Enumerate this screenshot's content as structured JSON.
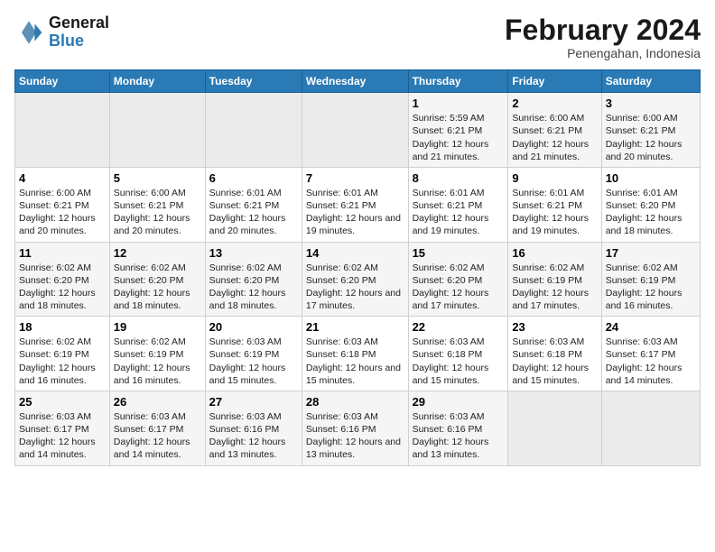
{
  "logo": {
    "text_general": "General",
    "text_blue": "Blue"
  },
  "header": {
    "title": "February 2024",
    "subtitle": "Penengahan, Indonesia"
  },
  "days_of_week": [
    "Sunday",
    "Monday",
    "Tuesday",
    "Wednesday",
    "Thursday",
    "Friday",
    "Saturday"
  ],
  "weeks": [
    [
      {
        "day": "",
        "info": ""
      },
      {
        "day": "",
        "info": ""
      },
      {
        "day": "",
        "info": ""
      },
      {
        "day": "",
        "info": ""
      },
      {
        "day": "1",
        "info": "Sunrise: 5:59 AM\nSunset: 6:21 PM\nDaylight: 12 hours and 21 minutes."
      },
      {
        "day": "2",
        "info": "Sunrise: 6:00 AM\nSunset: 6:21 PM\nDaylight: 12 hours and 21 minutes."
      },
      {
        "day": "3",
        "info": "Sunrise: 6:00 AM\nSunset: 6:21 PM\nDaylight: 12 hours and 20 minutes."
      }
    ],
    [
      {
        "day": "4",
        "info": "Sunrise: 6:00 AM\nSunset: 6:21 PM\nDaylight: 12 hours and 20 minutes."
      },
      {
        "day": "5",
        "info": "Sunrise: 6:00 AM\nSunset: 6:21 PM\nDaylight: 12 hours and 20 minutes."
      },
      {
        "day": "6",
        "info": "Sunrise: 6:01 AM\nSunset: 6:21 PM\nDaylight: 12 hours and 20 minutes."
      },
      {
        "day": "7",
        "info": "Sunrise: 6:01 AM\nSunset: 6:21 PM\nDaylight: 12 hours and 19 minutes."
      },
      {
        "day": "8",
        "info": "Sunrise: 6:01 AM\nSunset: 6:21 PM\nDaylight: 12 hours and 19 minutes."
      },
      {
        "day": "9",
        "info": "Sunrise: 6:01 AM\nSunset: 6:21 PM\nDaylight: 12 hours and 19 minutes."
      },
      {
        "day": "10",
        "info": "Sunrise: 6:01 AM\nSunset: 6:20 PM\nDaylight: 12 hours and 18 minutes."
      }
    ],
    [
      {
        "day": "11",
        "info": "Sunrise: 6:02 AM\nSunset: 6:20 PM\nDaylight: 12 hours and 18 minutes."
      },
      {
        "day": "12",
        "info": "Sunrise: 6:02 AM\nSunset: 6:20 PM\nDaylight: 12 hours and 18 minutes."
      },
      {
        "day": "13",
        "info": "Sunrise: 6:02 AM\nSunset: 6:20 PM\nDaylight: 12 hours and 18 minutes."
      },
      {
        "day": "14",
        "info": "Sunrise: 6:02 AM\nSunset: 6:20 PM\nDaylight: 12 hours and 17 minutes."
      },
      {
        "day": "15",
        "info": "Sunrise: 6:02 AM\nSunset: 6:20 PM\nDaylight: 12 hours and 17 minutes."
      },
      {
        "day": "16",
        "info": "Sunrise: 6:02 AM\nSunset: 6:19 PM\nDaylight: 12 hours and 17 minutes."
      },
      {
        "day": "17",
        "info": "Sunrise: 6:02 AM\nSunset: 6:19 PM\nDaylight: 12 hours and 16 minutes."
      }
    ],
    [
      {
        "day": "18",
        "info": "Sunrise: 6:02 AM\nSunset: 6:19 PM\nDaylight: 12 hours and 16 minutes."
      },
      {
        "day": "19",
        "info": "Sunrise: 6:02 AM\nSunset: 6:19 PM\nDaylight: 12 hours and 16 minutes."
      },
      {
        "day": "20",
        "info": "Sunrise: 6:03 AM\nSunset: 6:19 PM\nDaylight: 12 hours and 15 minutes."
      },
      {
        "day": "21",
        "info": "Sunrise: 6:03 AM\nSunset: 6:18 PM\nDaylight: 12 hours and 15 minutes."
      },
      {
        "day": "22",
        "info": "Sunrise: 6:03 AM\nSunset: 6:18 PM\nDaylight: 12 hours and 15 minutes."
      },
      {
        "day": "23",
        "info": "Sunrise: 6:03 AM\nSunset: 6:18 PM\nDaylight: 12 hours and 15 minutes."
      },
      {
        "day": "24",
        "info": "Sunrise: 6:03 AM\nSunset: 6:17 PM\nDaylight: 12 hours and 14 minutes."
      }
    ],
    [
      {
        "day": "25",
        "info": "Sunrise: 6:03 AM\nSunset: 6:17 PM\nDaylight: 12 hours and 14 minutes."
      },
      {
        "day": "26",
        "info": "Sunrise: 6:03 AM\nSunset: 6:17 PM\nDaylight: 12 hours and 14 minutes."
      },
      {
        "day": "27",
        "info": "Sunrise: 6:03 AM\nSunset: 6:16 PM\nDaylight: 12 hours and 13 minutes."
      },
      {
        "day": "28",
        "info": "Sunrise: 6:03 AM\nSunset: 6:16 PM\nDaylight: 12 hours and 13 minutes."
      },
      {
        "day": "29",
        "info": "Sunrise: 6:03 AM\nSunset: 6:16 PM\nDaylight: 12 hours and 13 minutes."
      },
      {
        "day": "",
        "info": ""
      },
      {
        "day": "",
        "info": ""
      }
    ]
  ]
}
